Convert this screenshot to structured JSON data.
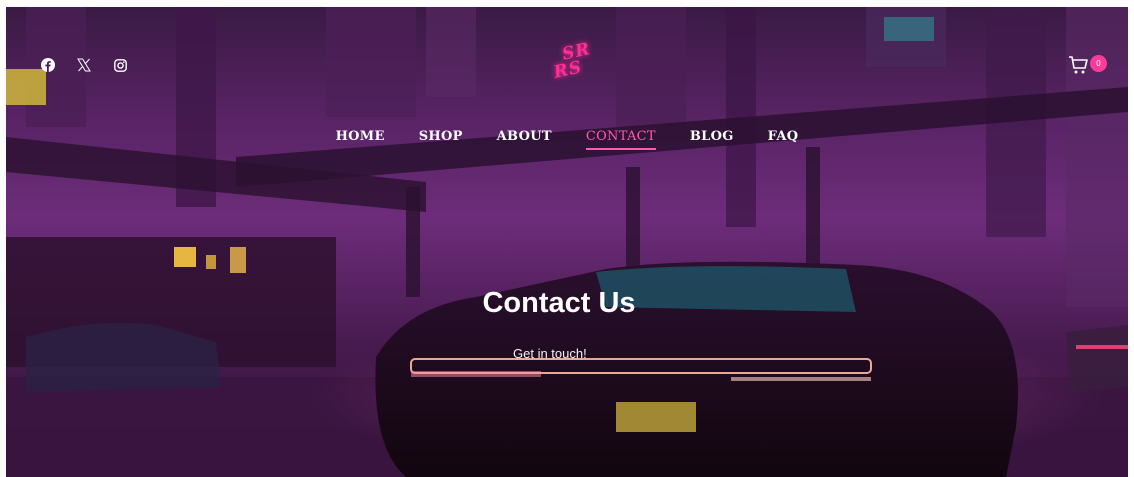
{
  "header": {
    "social": [
      {
        "icon": "facebook-icon"
      },
      {
        "icon": "x-twitter-icon"
      },
      {
        "icon": "instagram-icon"
      }
    ],
    "logo": {
      "line1": "SR",
      "line2": "RS"
    },
    "cart": {
      "icon": "cart-icon",
      "count": "0"
    }
  },
  "nav": {
    "items": [
      {
        "label": "HOME"
      },
      {
        "label": "SHOP"
      },
      {
        "label": "ABOUT"
      },
      {
        "label": "CONTACT",
        "active": true
      },
      {
        "label": "BLOG"
      },
      {
        "label": "FAQ"
      }
    ]
  },
  "hero": {
    "title": "Contact Us",
    "subtitle": "Get in touch!"
  },
  "colors": {
    "accent": "#ff3b9a",
    "active_nav": "#ff5ab0",
    "background_purple": "#5a2466"
  }
}
